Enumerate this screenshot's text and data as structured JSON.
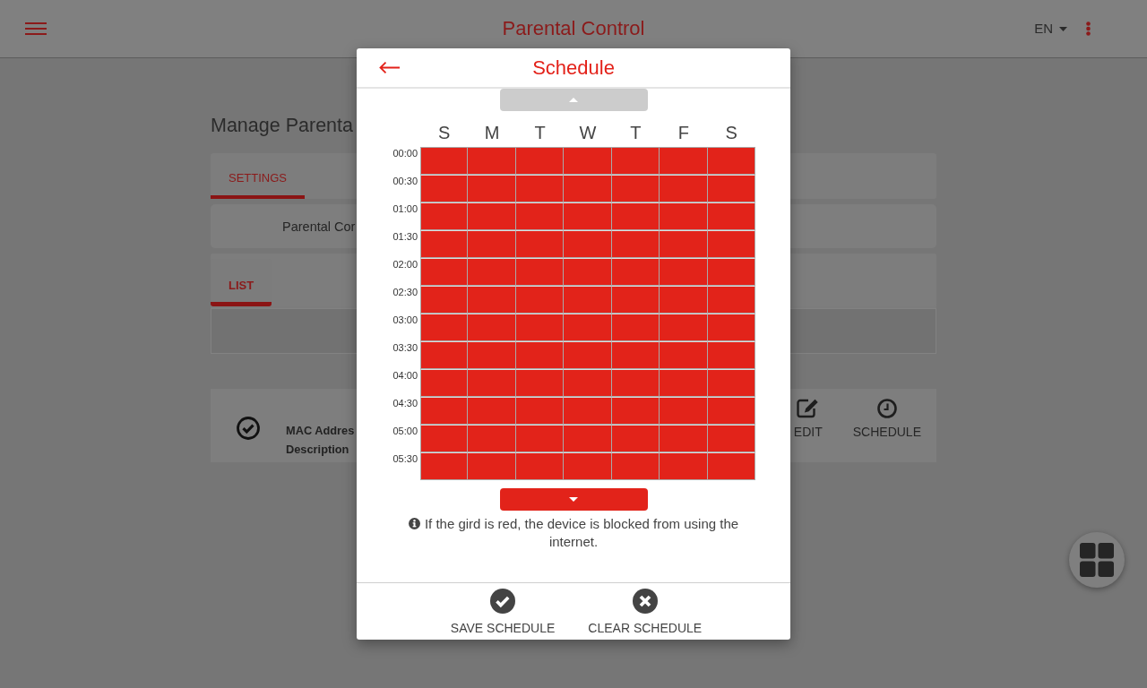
{
  "header": {
    "title": "Parental Control",
    "language": "EN"
  },
  "page": {
    "title": "Manage Parenta",
    "settings": {
      "tabs": [
        {
          "label": "SETTINGS",
          "selected": true
        }
      ],
      "rows": [
        "Parental Cor"
      ]
    },
    "list": {
      "tabs": [
        {
          "label": "LIST",
          "selected": true
        }
      ]
    },
    "devices": [
      {
        "enabled": true,
        "fields": [
          "MAC Addres",
          "Description"
        ],
        "actions": [
          {
            "kind": "edit",
            "label": "EDIT"
          },
          {
            "kind": "schedule",
            "label": "SCHEDULE"
          }
        ]
      }
    ]
  },
  "dialog": {
    "title": "Schedule",
    "scroll_up": {
      "disabled": true
    },
    "days": [
      "S",
      "M",
      "T",
      "W",
      "T",
      "F",
      "S"
    ],
    "rows": [
      {
        "time": "00:00",
        "blocked": [
          true,
          true,
          true,
          true,
          true,
          true,
          true
        ]
      },
      {
        "time": "00:30",
        "blocked": [
          true,
          true,
          true,
          true,
          true,
          true,
          true
        ]
      },
      {
        "time": "01:00",
        "blocked": [
          true,
          true,
          true,
          true,
          true,
          true,
          true
        ]
      },
      {
        "time": "01:30",
        "blocked": [
          true,
          true,
          true,
          true,
          true,
          true,
          true
        ]
      },
      {
        "time": "02:00",
        "blocked": [
          true,
          true,
          true,
          true,
          true,
          true,
          true
        ]
      },
      {
        "time": "02:30",
        "blocked": [
          true,
          true,
          true,
          true,
          true,
          true,
          true
        ]
      },
      {
        "time": "03:00",
        "blocked": [
          true,
          true,
          true,
          true,
          true,
          true,
          true
        ]
      },
      {
        "time": "03:30",
        "blocked": [
          true,
          true,
          true,
          true,
          true,
          true,
          true
        ]
      },
      {
        "time": "04:00",
        "blocked": [
          true,
          true,
          true,
          true,
          true,
          true,
          true
        ]
      },
      {
        "time": "04:30",
        "blocked": [
          true,
          true,
          true,
          true,
          true,
          true,
          true
        ]
      },
      {
        "time": "05:00",
        "blocked": [
          true,
          true,
          true,
          true,
          true,
          true,
          true
        ]
      },
      {
        "time": "05:30",
        "blocked": [
          true,
          true,
          true,
          true,
          true,
          true,
          true
        ]
      }
    ],
    "scroll_down": {
      "disabled": false
    },
    "note": "If the gird is red, the device is blocked from using the internet.",
    "actions": [
      {
        "kind": "save",
        "label": "SAVE SCHEDULE"
      },
      {
        "kind": "clear",
        "label": "CLEAR SCHEDULE"
      }
    ]
  }
}
